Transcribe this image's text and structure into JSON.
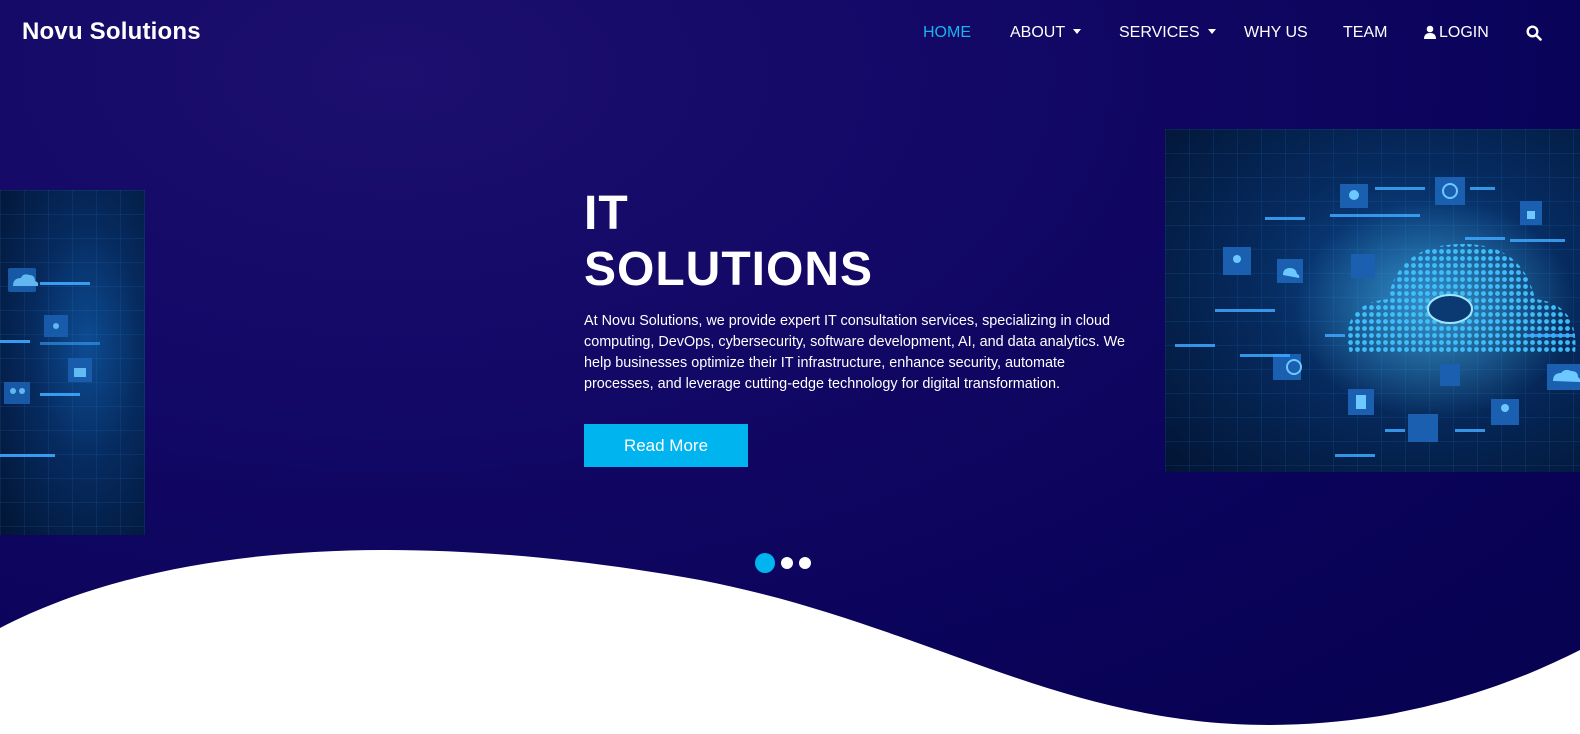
{
  "brand": {
    "name": "Novu Solutions"
  },
  "nav": {
    "items": [
      {
        "label": "HOME",
        "active": true
      },
      {
        "label": "ABOUT",
        "dropdown": true
      },
      {
        "label": "SERVICES",
        "dropdown": true
      },
      {
        "label": "WHY US"
      },
      {
        "label": "TEAM"
      },
      {
        "label": "LOGIN",
        "icon": "user-icon"
      }
    ],
    "search_icon": "search-icon"
  },
  "hero": {
    "title_line1": "IT",
    "title_line2": "SOLUTIONS",
    "description": "At Novu Solutions, we provide expert IT consultation services, specializing in cloud computing, DevOps, cybersecurity, software development, AI, and data analytics. We help businesses optimize their IT infrastructure, enhance security, automate processes, and leverage cutting-edge technology for digital transformation.",
    "button_label": "Read More"
  },
  "carousel": {
    "slide_count": 3,
    "active_index": 0
  },
  "colors": {
    "background": "#0a035a",
    "accent": "#00b4ef",
    "text": "#ffffff",
    "wave": "#ffffff"
  }
}
